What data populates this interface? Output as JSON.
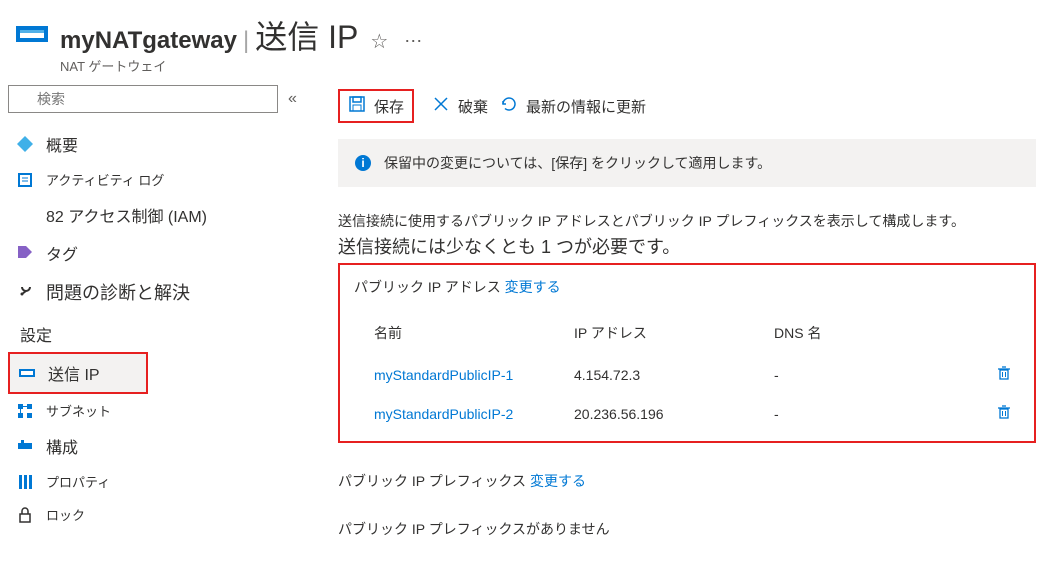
{
  "header": {
    "resource_name": "myNATgateway",
    "separator": "|",
    "page_title": "送信 IP",
    "subtitle": "NAT ゲートウェイ"
  },
  "sidebar": {
    "search_placeholder": "検索",
    "items": {
      "overview": "概要",
      "activity_log": "アクティビティ ログ",
      "access_control": "82 アクセス制御 (IAM)",
      "tags": "タグ",
      "diagnose": "問題の診断と解決"
    },
    "section_settings": "設定",
    "settings_items": {
      "outbound_ip": "送信 IP",
      "subnets": "サブネット",
      "configuration": "構成",
      "properties": "プロパティ",
      "locks": "ロック"
    }
  },
  "toolbar": {
    "save": "保存",
    "discard": "破棄",
    "refresh": "最新の情報に更新"
  },
  "info_banner": "保留中の変更については、[保存] をクリックして適用します。",
  "description": {
    "line1": "送信接続に使用するパブリック IP アドレスとパブリック IP プレフィックスを表示して構成します。",
    "line2": "送信接続には少なくとも 1 つが必要です。"
  },
  "ip_section": {
    "label_prefix": "パブリック IP アドレス",
    "label_change": "変更する",
    "columns": {
      "name": "名前",
      "ip": "IP アドレス",
      "dns": "DNS 名"
    },
    "rows": [
      {
        "name": "myStandardPublicIP-1",
        "ip": "4.154.72.3",
        "dns": "-"
      },
      {
        "name": "myStandardPublicIP-2",
        "ip": "20.236.56.196",
        "dns": "-"
      }
    ]
  },
  "prefix_section": {
    "label_prefix": "パブリック IP プレフィックス",
    "label_change": "変更する",
    "empty": "パブリック IP プレフィックスがありません"
  }
}
